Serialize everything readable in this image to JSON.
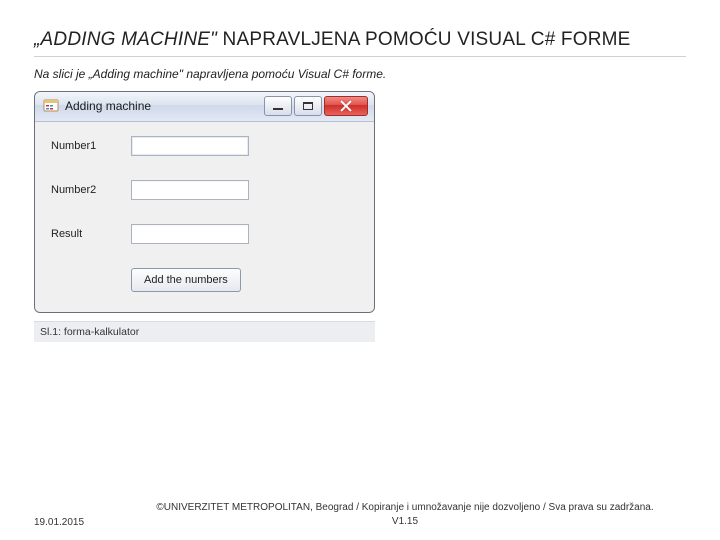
{
  "slide": {
    "title_prefix": "„ADDING MACHINE\"",
    "title_rest": " NAPRAVLJENA POMOĆU VISUAL C# FORME",
    "subtitle": "Na slici je „Adding machine\" napravljena pomoću Visual C# forme.",
    "caption": "Sl.1: forma-kalkulator"
  },
  "window": {
    "title": "Adding machine",
    "labels": {
      "number1": "Number1",
      "number2": "Number2",
      "result": "Result"
    },
    "button": "Add the numbers",
    "values": {
      "number1": "",
      "number2": "",
      "result": ""
    }
  },
  "footer": {
    "date": "19.01.2015",
    "copyright": "©UNIVERZITET METROPOLITAN, Beograd / Kopiranje i umnožavanje nije dozvoljeno / Sva prava su zadržana.",
    "version": "V1.15"
  }
}
